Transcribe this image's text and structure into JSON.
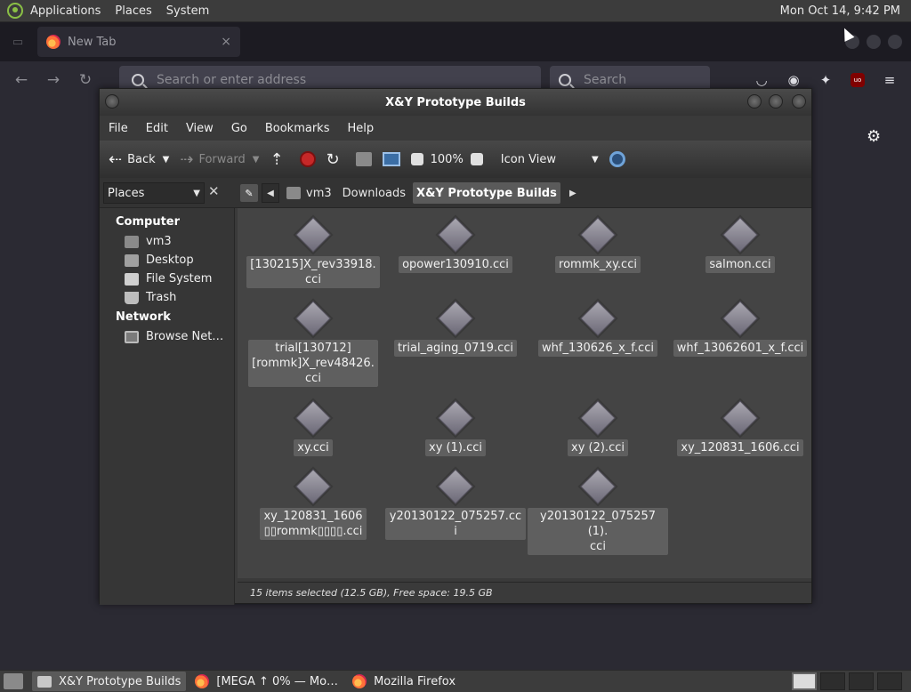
{
  "top_panel": {
    "menus": [
      "Applications",
      "Places",
      "System"
    ],
    "clock": "Mon Oct 14,  9:42 PM"
  },
  "firefox": {
    "tab_title": "New Tab",
    "tab_close": "×",
    "address_placeholder": "Search or enter address",
    "search_placeholder": "Search",
    "back_glyph": "←",
    "forward_glyph": "→",
    "reload_glyph": "↻",
    "ublock_text": "uo",
    "settings_glyph": "⚙"
  },
  "file_manager": {
    "title": "X&Y Prototype Builds",
    "menubar": [
      "File",
      "Edit",
      "View",
      "Go",
      "Bookmarks",
      "Help"
    ],
    "toolbar": {
      "back_label": "Back",
      "forward_label": "Forward",
      "zoom": "100%",
      "view_mode": "Icon View"
    },
    "places_label": "Places",
    "places_close": "✕",
    "breadcrumbs": [
      "vm3",
      "Downloads",
      "X&Y Prototype Builds"
    ],
    "sidebar": {
      "computer_heading": "Computer",
      "computer_items": [
        "vm3",
        "Desktop",
        "File System",
        "Trash"
      ],
      "network_heading": "Network",
      "network_items": [
        "Browse Net…"
      ]
    },
    "files": [
      "[130215]X_rev33918.\ncci",
      "opower130910.cci",
      "rommk_xy.cci",
      "salmon.cci",
      "trial[130712]\n[rommk]X_rev48426.\ncci",
      "trial_aging_0719.cci",
      "whf_130626_x_f.cci",
      "whf_13062601_x_f.cci",
      "xy.cci",
      "xy (1).cci",
      "xy (2).cci",
      "xy_120831_1606.cci",
      "xy_120831_1606\n▯▯rommk▯▯▯▯.cci",
      "y20130122_075257.cci",
      "y20130122_075257 (1).\ncci"
    ],
    "status": "15 items selected (12.5 GB), Free space: 19.5 GB"
  },
  "taskbar": {
    "items": [
      "X&Y Prototype Builds",
      "[MEGA ↑ 0% — Mo…",
      "Mozilla Firefox"
    ]
  }
}
